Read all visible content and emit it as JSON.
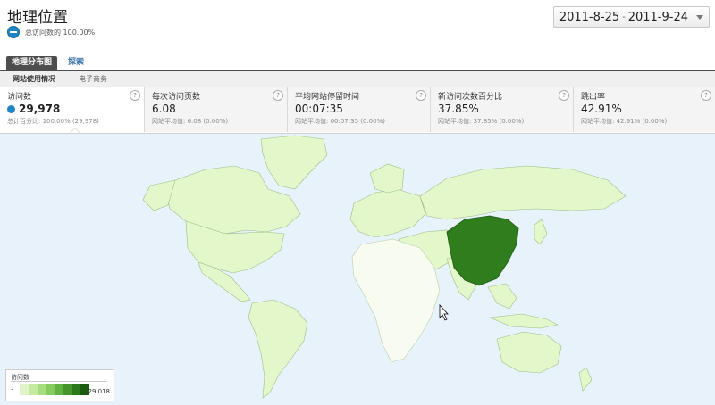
{
  "header": {
    "title": "地理位置",
    "segment_label": "总访问数的 100.00%",
    "date_start": "2011-8-25",
    "date_sep": "-",
    "date_end": "2011-9-24"
  },
  "tabs": [
    {
      "label": "地理分布图",
      "active": true
    },
    {
      "label": "探索",
      "active": false
    }
  ],
  "subtabs": [
    {
      "label": "网站使用情况",
      "active": true
    },
    {
      "label": "电子商务",
      "active": false
    }
  ],
  "metrics": [
    {
      "label": "访问数",
      "value": "29,978",
      "sub": "总计百分比: 100.00% (29,978)",
      "selected": true
    },
    {
      "label": "每次访问页数",
      "value": "6.08",
      "sub": "网站平均值: 6.08 (0.00%)",
      "selected": false
    },
    {
      "label": "平均网站停留时间",
      "value": "00:07:35",
      "sub": "网站平均值: 00:07:35 (0.00%)",
      "selected": false
    },
    {
      "label": "新访问次数百分比",
      "value": "37.85%",
      "sub": "网站平均值: 37.85% (0.00%)",
      "selected": false
    },
    {
      "label": "跳出率",
      "value": "42.91%",
      "sub": "网站平均值: 42.91% (0.00%)",
      "selected": false
    }
  ],
  "help_glyph": "?",
  "legend": {
    "title": "访问数",
    "min": "1",
    "max": "29,018",
    "colors": [
      "#dff5c8",
      "#c3eaa0",
      "#a6dd7e",
      "#86cc5f",
      "#63b343",
      "#43952c",
      "#2a7a1a",
      "#1b5c10"
    ]
  },
  "map": {
    "ocean_color": "#e8f2fa",
    "low_color": "#e3f7cb",
    "none_color": "#f8fbf0",
    "high_color": "#2f7d1d",
    "highlighted_country": "China"
  }
}
